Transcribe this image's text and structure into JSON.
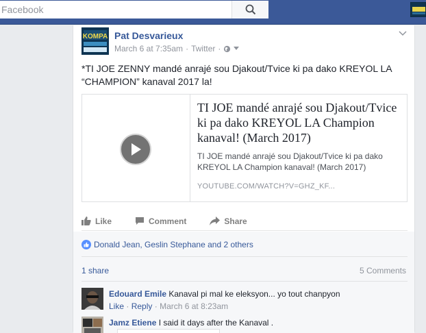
{
  "search": {
    "placeholder": "Facebook"
  },
  "post": {
    "author": "Pat Desvarieux",
    "time": "March 6 at 7:35am",
    "source": "Twitter",
    "separator": "·",
    "text": "*TI JOE ZENNY mandé anrajé sou Djakout/Tvice ki pa dako KREYOL LA “CHAMPION” kanaval 2017 la!",
    "avatar_label": "KOMPA"
  },
  "link": {
    "title": "TI JOE mandé anrajé sou Djakout/Tvice ki pa dako KREYOL LA Champion kanaval! (March 2017)",
    "description": "TI JOE mandé anrajé sou Djakout/Tvice ki pa dako KREYOL LA Champion kanaval! (March 2017)",
    "domain": "YOUTUBE.COM/WATCH?V=GHZ_KF..."
  },
  "actions": {
    "like": "Like",
    "comment": "Comment",
    "share": "Share"
  },
  "reactions": {
    "likes_text": "Donald Jean, Geslin Stephane and 2 others"
  },
  "stats": {
    "shares": "1 share",
    "comments": "5 Comments"
  },
  "comments": [
    {
      "name": "Edouard Emile",
      "text": "Kanaval pi mal ke eleksyon... yo tout chanpyon",
      "like": "Like",
      "reply": "Reply",
      "time": "March 6 at 8:23am"
    },
    {
      "name": "Jamz Etiene",
      "text": "I said it days after the Kanaval ."
    }
  ],
  "colors": {
    "brand": "#3b5998",
    "link": "#365899",
    "muted": "#90949c"
  }
}
